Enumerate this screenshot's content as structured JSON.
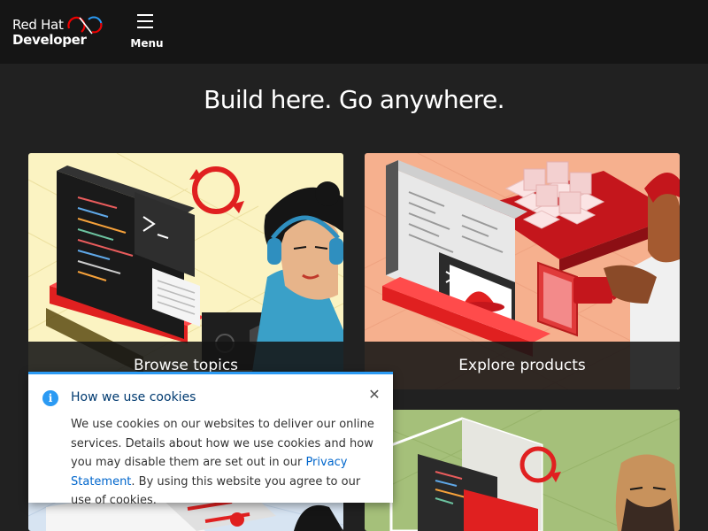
{
  "brand": {
    "line1": "Red Hat",
    "line2": "Developer"
  },
  "header": {
    "menu_label": "Menu"
  },
  "hero": {
    "title": "Build here. Go anywhere."
  },
  "cards": [
    {
      "label": "Browse topics"
    },
    {
      "label": "Explore products"
    },
    {
      "label": ""
    },
    {
      "label": ""
    }
  ],
  "cookie_banner": {
    "title": "How we use cookies",
    "close_icon": "close-icon",
    "text_before_link": "We use cookies on our websites to deliver our online services. Details about how we use cookies and how you may disable them are set out in our ",
    "link_text": "Privacy Statement",
    "text_after_link": ". By using this website you agree to our use of cookies."
  },
  "colors": {
    "header_bg": "#151515",
    "page_bg": "#212121",
    "brand_red": "#ee0000",
    "link_blue": "#0066cc",
    "info_blue": "#2b9af3"
  }
}
